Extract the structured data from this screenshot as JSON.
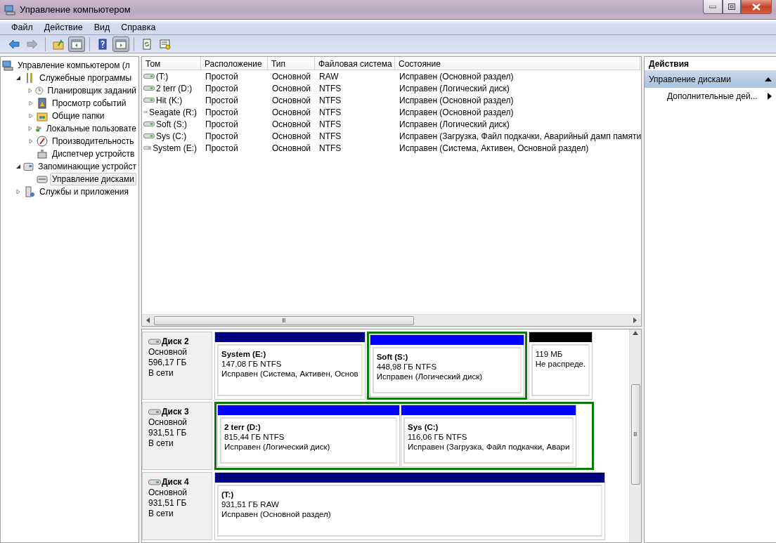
{
  "window": {
    "title": "Управление компьютером"
  },
  "menu": [
    "Файл",
    "Действие",
    "Вид",
    "Справка"
  ],
  "toolbar": [
    {
      "kind": "back",
      "disabled": false,
      "pressed": false
    },
    {
      "kind": "forward",
      "disabled": true,
      "pressed": false
    },
    {
      "kind": "up",
      "disabled": false,
      "pressed": false
    },
    {
      "kind": "tree-toggle",
      "disabled": false,
      "pressed": true
    },
    {
      "kind": "help",
      "disabled": false,
      "pressed": false
    },
    {
      "kind": "pane-toggle",
      "disabled": false,
      "pressed": true
    },
    {
      "kind": "refresh",
      "disabled": false,
      "pressed": false
    },
    {
      "kind": "properties",
      "disabled": false,
      "pressed": false
    }
  ],
  "tree": [
    {
      "label": "Управление компьютером (л",
      "selected": false,
      "children": [
        {
          "label": "Служебные программы",
          "kind": "folder",
          "expanded": true,
          "selected": false,
          "children": [
            {
              "label": "Планировщик заданий",
              "kind": "folder",
              "expanded": false,
              "selected": false
            },
            {
              "label": "Просмотр событий",
              "kind": "folder",
              "expanded": false,
              "selected": false
            },
            {
              "label": "Общие папки",
              "kind": "folder",
              "expanded": false,
              "selected": false
            },
            {
              "label": "Локальные пользовате",
              "kind": "folder",
              "expanded": false,
              "selected": false
            },
            {
              "label": "Производительность",
              "kind": "folder",
              "expanded": false,
              "selected": false
            },
            {
              "label": "Диспетчер устройств",
              "kind": "leaf",
              "selected": false
            }
          ]
        },
        {
          "label": "Запоминающие устройст",
          "kind": "folder",
          "expanded": true,
          "selected": false,
          "children": [
            {
              "label": "Управление дисками",
              "kind": "leaf",
              "selected": true
            }
          ]
        },
        {
          "label": "Службы и приложения",
          "kind": "folder",
          "expanded": false,
          "selected": false
        }
      ]
    }
  ],
  "volumes": {
    "columns": [
      "Том",
      "Расположение",
      "Тип",
      "Файловая система",
      "Состояние"
    ],
    "rows": [
      {
        "volume": " (T:)",
        "layout": "Простой",
        "type": "Основной",
        "fs": "RAW",
        "status": "Исправен (Основной раздел)"
      },
      {
        "volume": "2 terr (D:)",
        "layout": "Простой",
        "type": "Основной",
        "fs": "NTFS",
        "status": "Исправен (Логический диск)"
      },
      {
        "volume": "Hit (K:)",
        "layout": "Простой",
        "type": "Основной",
        "fs": "NTFS",
        "status": "Исправен (Основной раздел)"
      },
      {
        "volume": "Seagate (R:)",
        "layout": "Простой",
        "type": "Основной",
        "fs": "NTFS",
        "status": "Исправен (Основной раздел)"
      },
      {
        "volume": "Soft (S:)",
        "layout": "Простой",
        "type": "Основной",
        "fs": "NTFS",
        "status": "Исправен (Логический диск)"
      },
      {
        "volume": "Sys (C:)",
        "layout": "Простой",
        "type": "Основной",
        "fs": "NTFS",
        "status": "Исправен (Загрузка, Файл подкачки, Аварийный дамп памяти"
      },
      {
        "volume": "System (E:)",
        "layout": "Простой",
        "type": "Основной",
        "fs": "NTFS",
        "status": "Исправен (Система, Активен, Основной раздел)"
      }
    ],
    "scroll_grip": "Ⅲ"
  },
  "disks": [
    {
      "name": "Диск 2",
      "type": "Основной",
      "size": "596,17 ГБ",
      "status": "В сети",
      "segments": [
        {
          "kind": "primary",
          "name": "System  (E:)",
          "size": "147,08 ГБ NTFS",
          "status": "Исправен (Система, Активен, Основ"
        },
        {
          "kind": "extended",
          "children": [
            {
              "kind": "logical",
              "name": "Soft  (S:)",
              "size": "448,98 ГБ NTFS",
              "status": "Исправен (Логический диск)"
            }
          ]
        },
        {
          "kind": "unallocated",
          "size": "119 МБ",
          "status": "Не распреде."
        }
      ]
    },
    {
      "name": "Диск 3",
      "type": "Основной",
      "size": "931,51 ГБ",
      "status": "В сети",
      "segments": [
        {
          "kind": "extended",
          "children": [
            {
              "kind": "logical",
              "name": "2 terr  (D:)",
              "size": "815,44 ГБ NTFS",
              "status": "Исправен (Логический диск)"
            },
            {
              "kind": "logical",
              "name": "Sys  (C:)",
              "size": "116,06 ГБ NTFS",
              "status": "Исправен (Загрузка, Файл подкачки, Авари"
            }
          ]
        }
      ]
    },
    {
      "name": "Диск 4",
      "type": "Основной",
      "size": "931,51 ГБ",
      "status": "В сети",
      "segments": [
        {
          "kind": "primary",
          "name": " (T:)",
          "size": "931,51 ГБ RAW",
          "status": "Исправен (Основной раздел)"
        }
      ]
    }
  ],
  "disks_scroll_grip": "Ⅲ",
  "actions": {
    "title": "Действия",
    "section": {
      "label": "Управление дисками",
      "expanded": true
    },
    "items": [
      {
        "label": "Дополнительные дей..."
      }
    ]
  }
}
